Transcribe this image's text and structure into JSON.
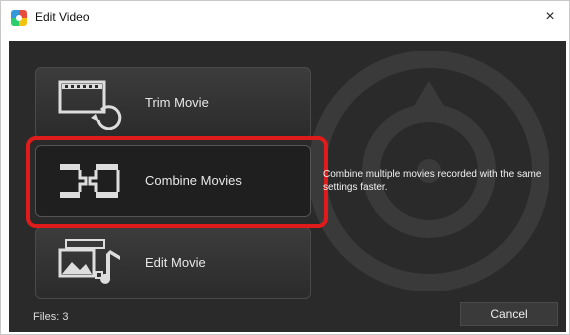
{
  "window": {
    "title": "Edit Video",
    "close_glyph": "×"
  },
  "buttons": [
    {
      "label": "Trim Movie",
      "icon": "trim-icon"
    },
    {
      "label": "Combine Movies",
      "icon": "combine-icon"
    },
    {
      "label": "Edit Movie",
      "icon": "edit-movie-icon"
    }
  ],
  "description": "Combine multiple movies recorded with the same settings faster.",
  "footer": {
    "files": "Files: 3",
    "cancel_label": "Cancel"
  },
  "colors": {
    "panel_bg": "#2a2a2a",
    "highlight": "#e01b1b",
    "text_light": "#eeeeee"
  }
}
